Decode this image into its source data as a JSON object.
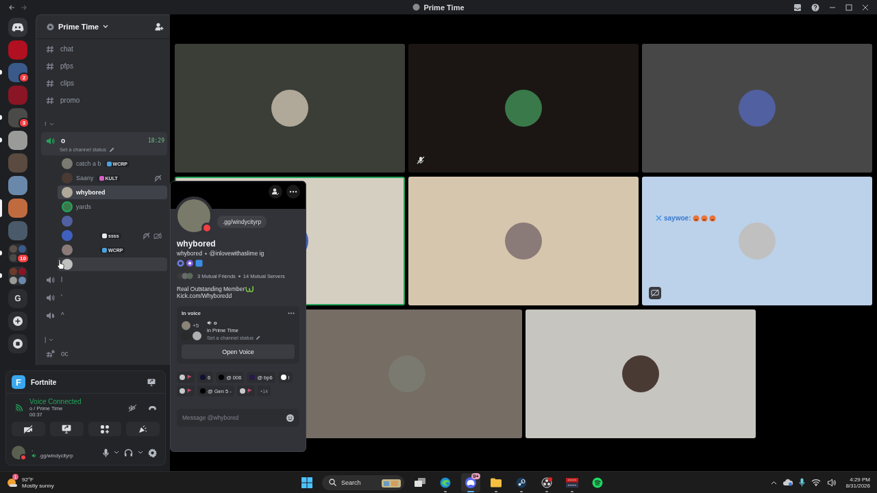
{
  "window": {
    "title": "Prime Time"
  },
  "servers": [
    {
      "kind": "home",
      "unread": false,
      "selected": false
    },
    {
      "kind": "server",
      "unread": false,
      "selected": false
    },
    {
      "kind": "server",
      "unread": true,
      "selected": false,
      "badge": "2"
    },
    {
      "kind": "server",
      "unread": false,
      "selected": false
    },
    {
      "kind": "server",
      "unread": true,
      "selected": false,
      "badge": "3"
    },
    {
      "kind": "server",
      "unread": true,
      "selected": false
    },
    {
      "kind": "server",
      "unread": false,
      "selected": false
    },
    {
      "kind": "server",
      "unread": false,
      "selected": false
    },
    {
      "kind": "server",
      "unread": false,
      "selected": true
    },
    {
      "kind": "server",
      "unread": false,
      "selected": false
    },
    {
      "kind": "folder",
      "unread": true,
      "selected": false,
      "badge": "10"
    },
    {
      "kind": "folder",
      "unread": true,
      "selected": false
    },
    {
      "kind": "letter",
      "label": "G",
      "unread": false,
      "selected": false
    },
    {
      "kind": "add",
      "unread": false,
      "selected": false
    },
    {
      "kind": "discover",
      "unread": false,
      "selected": false
    }
  ],
  "server_name": "Prime Time",
  "channels": [
    {
      "kind": "text",
      "name": "chat",
      "locked": false
    },
    {
      "kind": "text",
      "name": "pfps",
      "locked": false
    },
    {
      "kind": "text",
      "name": "clips",
      "locked": false
    },
    {
      "kind": "text",
      "name": "promo",
      "locked": false
    },
    {
      "kind": "category",
      "name": "!",
      "expanded": true
    },
    {
      "kind": "voice",
      "name": "o",
      "selected": true,
      "time": "18:29",
      "status": "Set a channel status",
      "members": [
        {
          "name": "catch a b",
          "tag": {
            "text": "WCRP",
            "color": "#4aa3df"
          },
          "selected": false,
          "hovered": false,
          "speaking": false,
          "deafened": false,
          "video_off": false
        },
        {
          "name": "Saany",
          "tag": {
            "text": "KULT",
            "color": "#d55fc6"
          },
          "selected": false,
          "hovered": false,
          "speaking": false,
          "deafened": true,
          "video_off": false
        },
        {
          "name": "whybored",
          "selected": true,
          "hovered": false,
          "speaking": false,
          "deafened": false,
          "video_off": false
        },
        {
          "name": "yards",
          "selected": false,
          "hovered": false,
          "speaking": true,
          "deafened": false,
          "video_off": false
        },
        {
          "selected": false,
          "hovered": false,
          "speaking": false,
          "deafened": false,
          "video_off": false
        },
        {
          "tag": {
            "text": "ssss",
            "color": "#e8e8e8"
          },
          "selected": false,
          "hovered": false,
          "speaking": false,
          "deafened": true,
          "video_off": true
        },
        {
          "tag": {
            "text": "WCRP",
            "color": "#4aa3df"
          },
          "selected": false,
          "hovered": false,
          "speaking": false,
          "deafened": false,
          "video_off": false
        },
        {
          "selected": false,
          "hovered": true,
          "speaking": false,
          "deafened": false,
          "video_off": false
        }
      ]
    },
    {
      "kind": "voice",
      "name": "l",
      "selected": false
    },
    {
      "kind": "voice",
      "name": "'",
      "selected": false
    },
    {
      "kind": "stage",
      "name": "^",
      "selected": false
    },
    {
      "kind": "category",
      "name": "|",
      "expanded": true
    },
    {
      "kind": "text",
      "name": "oc",
      "locked": true
    }
  ],
  "activity": {
    "logo": "F",
    "name": "Fortnite"
  },
  "voice": {
    "status": "Voice Connected",
    "channel": "o / Prime Time",
    "elapsed": "00:37"
  },
  "user": {
    "name": ".",
    "status": ".gg/windycityrp",
    "dnd": true
  },
  "tiles": [
    {
      "color": "#3b3e37",
      "speaking": false,
      "muted": false,
      "stream_off": false
    },
    {
      "color": "#1b1613",
      "speaking": false,
      "muted": true,
      "stream_off": false
    },
    {
      "color": "#474747",
      "speaking": false,
      "muted": false,
      "stream_off": false
    },
    {
      "color": "#d5cfc1",
      "speaking": true,
      "muted": false,
      "stream_off": false
    },
    {
      "color": "#d6c6ad",
      "speaking": false,
      "muted": false,
      "stream_off": false
    },
    {
      "color": "#bcd1ea",
      "speaking": false,
      "muted": false,
      "stream_off": true,
      "caption": "saywoe:"
    },
    {
      "color": "#766d65",
      "speaking": false,
      "muted": false,
      "stream_off": false
    },
    {
      "color": "#c6c5c0",
      "speaking": false,
      "muted": false,
      "stream_off": false
    }
  ],
  "profile": {
    "display_name": "whybored",
    "username": "whybored",
    "pronouns": "@inlovewithaslime ig",
    "custom_status": ".gg/windycityrp",
    "dnd": true,
    "mutual_friends": "3 Mutual Friends",
    "mutual_servers": "14 Mutual Servers",
    "bio": [
      "Real Outstanding Member",
      "Kick.com/Whyboredd"
    ],
    "in_voice": {
      "heading": "In voice",
      "extra": "+5",
      "channel": "o",
      "server": "in Prime Time",
      "status": "Set a channel status",
      "button": "Open Voice"
    },
    "roles": [
      {
        "color": "#c8c8c8"
      },
      {
        "color": "#101030",
        "label": "6"
      },
      {
        "color": "#000000",
        "label": "@ 006"
      },
      {
        "color": "#2a1a4a",
        "label": "@ bp6"
      },
      {
        "color": "#ffffff",
        "label": "I"
      },
      {
        "color": "#c8c8c8"
      },
      {
        "color": "#000000",
        "label": "@ Gen 5 -"
      },
      {
        "color": "#c8c8c8"
      }
    ],
    "more_roles": "+14",
    "message_placeholder": "Message @whybored"
  },
  "taskbar": {
    "weather": {
      "badge": "1",
      "temp": "92°F",
      "condition": "Mostly sunny"
    },
    "search": "Search",
    "apps": [
      {
        "kind": "taskview",
        "active": false,
        "running": false
      },
      {
        "kind": "edge",
        "active": false,
        "running": true
      },
      {
        "kind": "discord",
        "active": true,
        "running": true,
        "badge": "9+"
      },
      {
        "kind": "files",
        "active": false,
        "running": true
      },
      {
        "kind": "steam",
        "active": false,
        "running": true
      },
      {
        "kind": "obs",
        "active": false,
        "running": true
      },
      {
        "kind": "mixer",
        "active": false,
        "running": true
      },
      {
        "kind": "spotify",
        "active": false,
        "running": false
      }
    ],
    "time": "4:29 PM",
    "date": "8/31/2026"
  }
}
